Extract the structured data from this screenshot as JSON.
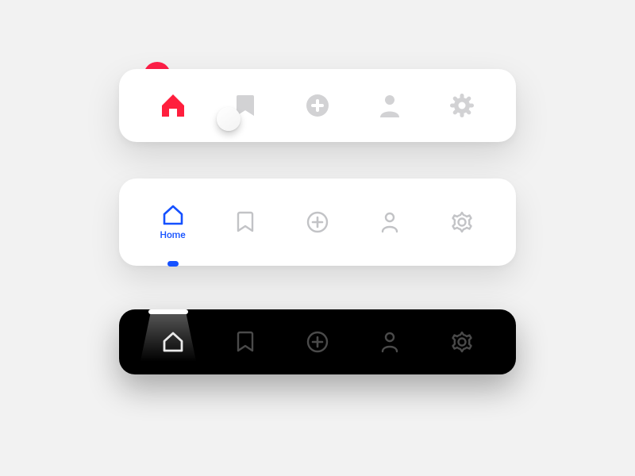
{
  "colors": {
    "accent_red": "#ff1f3d",
    "accent_blue": "#1551ff",
    "muted_fill": "#d2d2d4",
    "muted_stroke": "#c2c3c6",
    "dark_inactive": "#4a4a4a",
    "dark_active": "#e9e9e9"
  },
  "bar1": {
    "active_index": 0,
    "items": [
      {
        "id": "home",
        "icon": "home-filled"
      },
      {
        "id": "bookmarks",
        "icon": "bookmark-filled"
      },
      {
        "id": "add",
        "icon": "plus-circle-filled"
      },
      {
        "id": "profile",
        "icon": "person-filled"
      },
      {
        "id": "settings",
        "icon": "gear-filled"
      }
    ]
  },
  "bar2": {
    "active_index": 0,
    "items": [
      {
        "id": "home",
        "icon": "home-outline",
        "label": "Home"
      },
      {
        "id": "bookmarks",
        "icon": "bookmark-outline",
        "label": ""
      },
      {
        "id": "add",
        "icon": "plus-circle-outline",
        "label": ""
      },
      {
        "id": "profile",
        "icon": "person-outline",
        "label": ""
      },
      {
        "id": "settings",
        "icon": "gear-outline",
        "label": ""
      }
    ]
  },
  "bar3": {
    "active_index": 0,
    "items": [
      {
        "id": "home",
        "icon": "home-outline"
      },
      {
        "id": "bookmarks",
        "icon": "bookmark-outline"
      },
      {
        "id": "add",
        "icon": "plus-circle-outline"
      },
      {
        "id": "profile",
        "icon": "person-outline"
      },
      {
        "id": "settings",
        "icon": "gear-outline"
      }
    ]
  }
}
